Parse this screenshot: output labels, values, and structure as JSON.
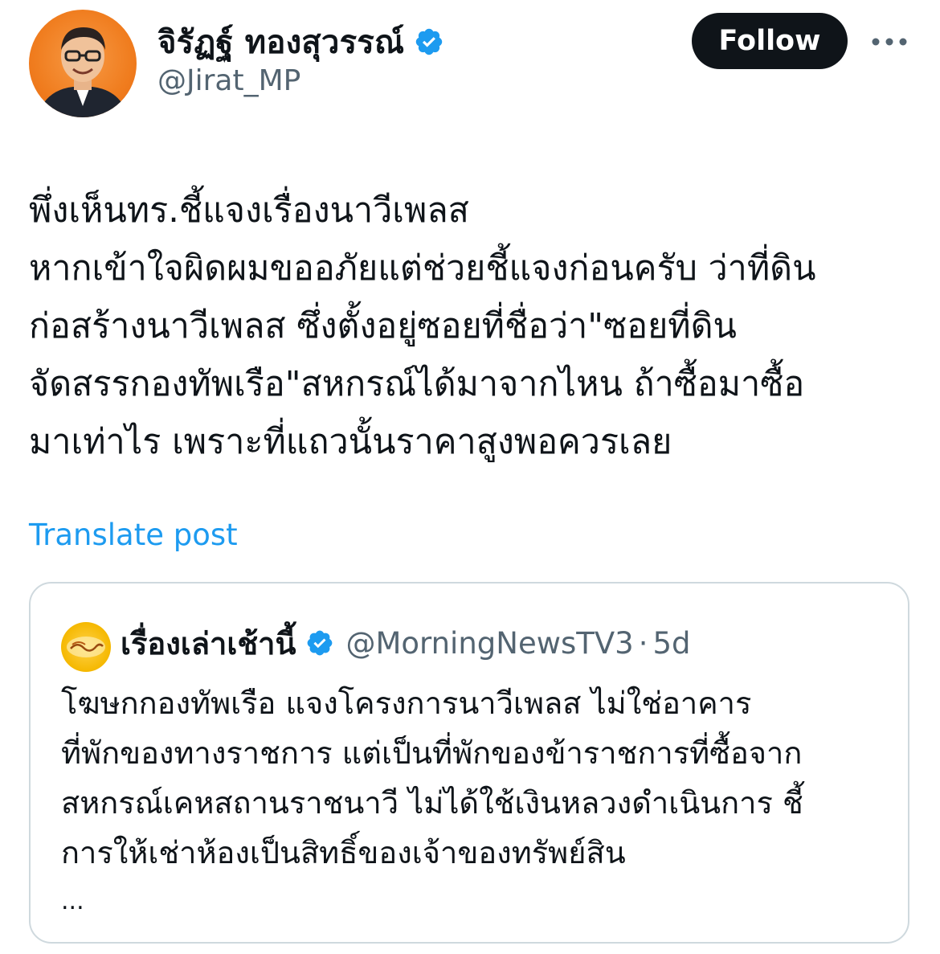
{
  "author": {
    "display_name": "จิรัฏฐ์ ทองสุวรรณ์",
    "handle": "@Jirat_MP",
    "verified_icon": "verified-badge-icon",
    "avatar_icon": "profile-photo"
  },
  "actions": {
    "follow_label": "Follow",
    "more_icon": "more-options-icon"
  },
  "tweet": {
    "lines": [
      "พึ่งเห็นทร.ชี้แจงเรื่องนาวีเพลส",
      "หากเข้าใจผิดผมขออภัยแต่ช่วยชี้แจงก่อนครับ ว่าที่ดิน",
      "ก่อสร้างนาวีเพลส ซึ่งตั้งอยู่ซอยที่ชื่อว่า\"ซอยที่ดิน",
      "จัดสรรกองทัพเรือ\"สหกรณ์ได้มาจากไหน ถ้าซื้อมาซื้อ",
      "มาเท่าไร เพราะที่แถวนั้นราคาสูงพอควรเลย"
    ],
    "translate_label": "Translate post"
  },
  "quoted_tweet": {
    "display_name": "เรื่องเล่าเช้านี้",
    "handle": "@MorningNewsTV3",
    "separator": "·",
    "time": "5d",
    "lines": [
      "โฆษกกองทัพเรือ แจงโครงการนาวีเพลส ไม่ใช่อาคาร",
      "ที่พักของทางราชการ แต่เป็นที่พักของข้าราชการที่ซื้อจาก",
      "สหกรณ์เคหสถานราชนาวี ไม่ได้ใช้เงินหลวงดำเนินการ ชี้",
      "การให้เช่าห้องเป็นสิทธิ์ของเจ้าของทรัพย์สิน"
    ],
    "ellipsis": "...",
    "avatar_icon": "morning-news-logo"
  },
  "colors": {
    "accent_link": "#1d9bf0",
    "verified_blue": "#1d9bf0",
    "secondary_text": "#536471",
    "primary_text": "#0f1419",
    "border": "#cfd9de",
    "avatar_orange": "#f07d1f"
  }
}
